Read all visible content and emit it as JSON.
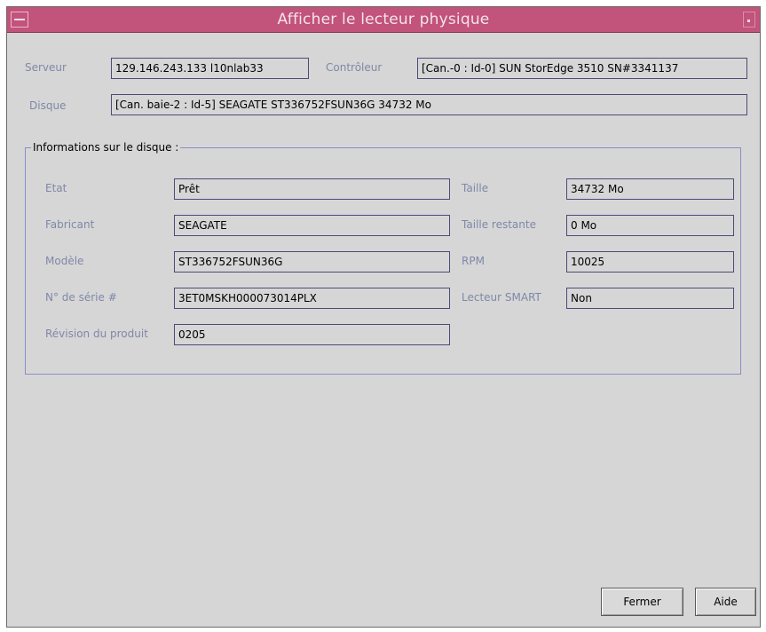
{
  "window": {
    "title": "Afficher le lecteur physique"
  },
  "top": {
    "serveur_label": "Serveur",
    "serveur_value": "129.146.243.133 l10nlab33",
    "controleur_label": "Contrôleur",
    "controleur_value": "[Can.-0 : Id-0] SUN StorEdge 3510 SN#3341137",
    "disque_label": "Disque",
    "disque_value": "[Can. baie-2 : Id-5] SEAGATE ST336752FSUN36G 34732 Mo"
  },
  "group": {
    "title": "Informations sur le disque :",
    "etat_label": "Etat",
    "etat_value": "Prêt",
    "fabricant_label": "Fabricant",
    "fabricant_value": "SEAGATE",
    "modele_label": "Modèle",
    "modele_value": "ST336752FSUN36G",
    "serie_label": "N° de série #",
    "serie_value": "3ET0MSKH000073014PLX",
    "revision_label": "Révision du produit",
    "revision_value": "0205",
    "taille_label": "Taille",
    "taille_value": "34732 Mo",
    "taille_restante_label": "Taille restante",
    "taille_restante_value": "0 Mo",
    "rpm_label": "RPM",
    "rpm_value": "10025",
    "smart_label": "Lecteur SMART",
    "smart_value": "Non"
  },
  "buttons": {
    "fermer": "Fermer",
    "aide": "Aide"
  },
  "icons": {
    "window_menu": "window-menu-icon",
    "maximize": "maximize-icon"
  },
  "colors": {
    "titlebar": "#c2537a",
    "label": "#7f88a8",
    "background": "#d6d6d6"
  }
}
